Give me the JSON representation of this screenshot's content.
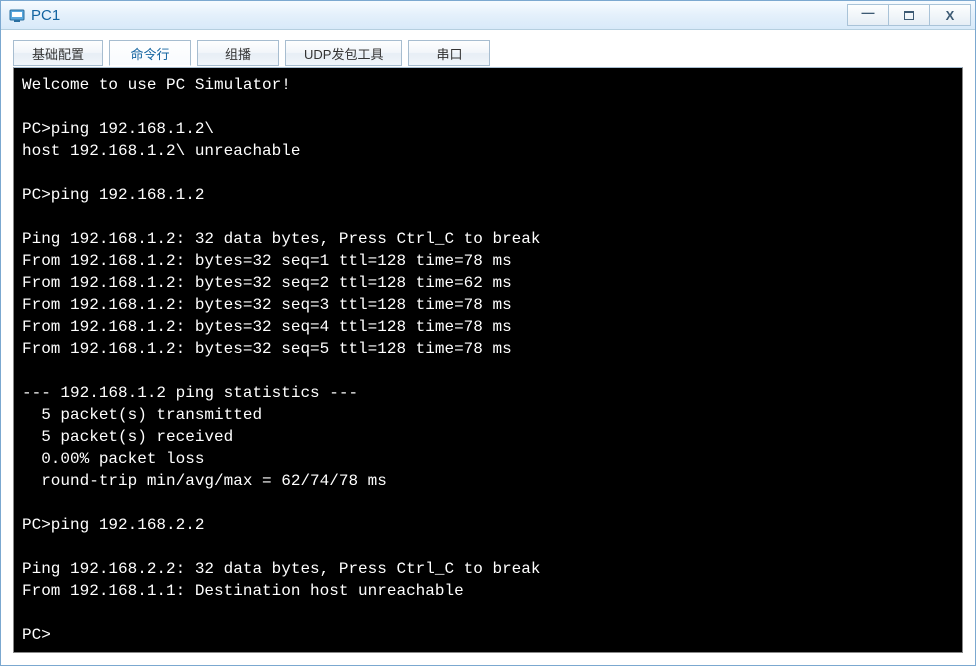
{
  "window": {
    "title": "PC1",
    "controls": {
      "minimize": "—",
      "close": "X"
    }
  },
  "tabs": {
    "items": [
      {
        "label": "基础配置",
        "active": false
      },
      {
        "label": "命令行",
        "active": true
      },
      {
        "label": "组播",
        "active": false
      },
      {
        "label": "UDP发包工具",
        "active": false
      },
      {
        "label": "串口",
        "active": false
      }
    ]
  },
  "terminal": {
    "lines": [
      "Welcome to use PC Simulator!",
      "",
      "PC>ping 192.168.1.2\\",
      "host 192.168.1.2\\ unreachable",
      "",
      "PC>ping 192.168.1.2",
      "",
      "Ping 192.168.1.2: 32 data bytes, Press Ctrl_C to break",
      "From 192.168.1.2: bytes=32 seq=1 ttl=128 time=78 ms",
      "From 192.168.1.2: bytes=32 seq=2 ttl=128 time=62 ms",
      "From 192.168.1.2: bytes=32 seq=3 ttl=128 time=78 ms",
      "From 192.168.1.2: bytes=32 seq=4 ttl=128 time=78 ms",
      "From 192.168.1.2: bytes=32 seq=5 ttl=128 time=78 ms",
      "",
      "--- 192.168.1.2 ping statistics ---",
      "  5 packet(s) transmitted",
      "  5 packet(s) received",
      "  0.00% packet loss",
      "  round-trip min/avg/max = 62/74/78 ms",
      "",
      "PC>ping 192.168.2.2",
      "",
      "Ping 192.168.2.2: 32 data bytes, Press Ctrl_C to break",
      "From 192.168.1.1: Destination host unreachable",
      "",
      "PC>"
    ]
  }
}
